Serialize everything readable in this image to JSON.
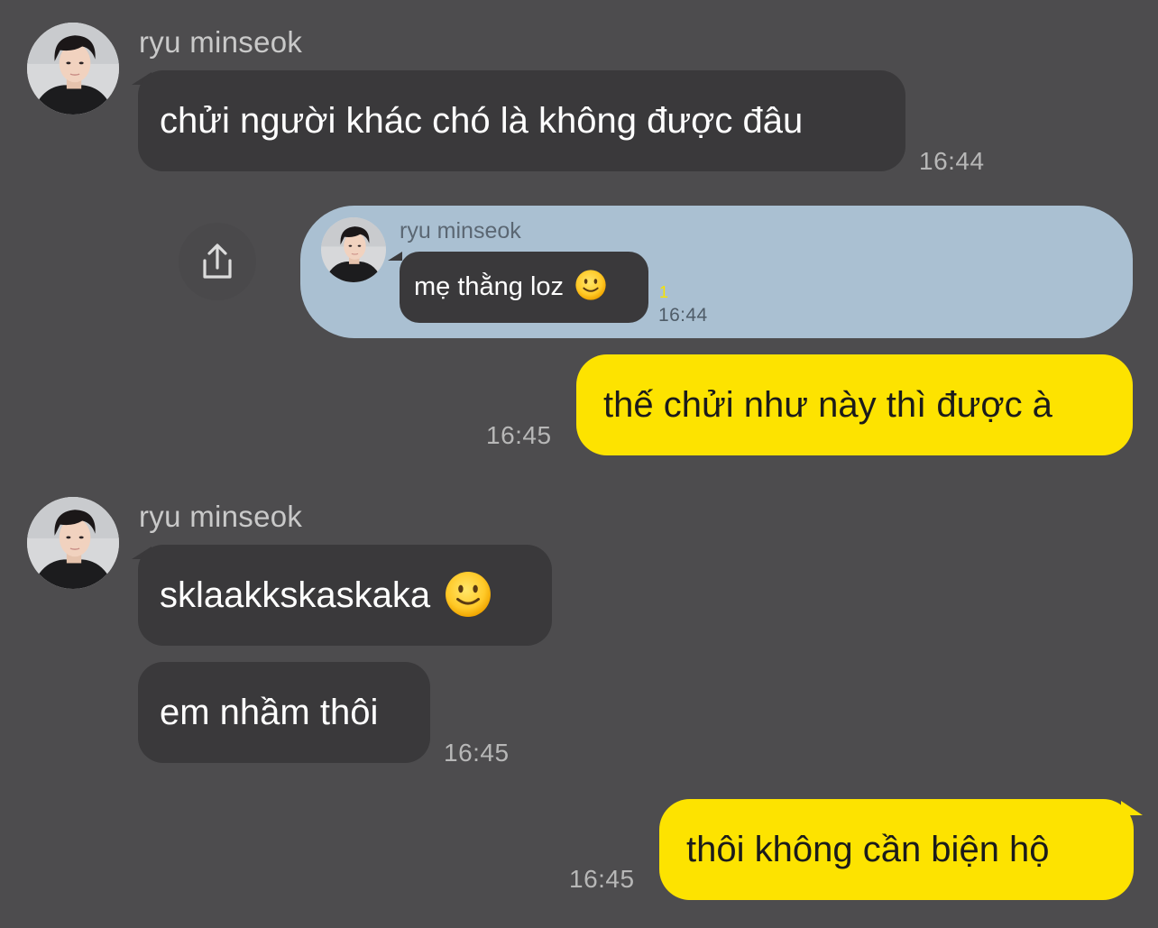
{
  "chat": {
    "groups": [
      {
        "sender": "ryu minseok",
        "messages": [
          {
            "text": "chửi người khác chó là không được đâu",
            "time": "16:44"
          }
        ]
      },
      {
        "sender": "ryu minseok",
        "messages": [
          {
            "text": "sklaakkskaskaka",
            "emoji": "slightly-smiling-face"
          },
          {
            "text": "em nhầm thôi",
            "time": "16:45"
          }
        ]
      }
    ],
    "forwarded": {
      "sender": "ryu minseok",
      "text": "mẹ thằng loz",
      "emoji": "slightly-smiling-face",
      "unread": "1",
      "time": "16:44",
      "share_icon": "share-icon"
    },
    "outgoing": [
      {
        "text": "thế chửi như này thì được à",
        "time": "16:45"
      },
      {
        "text": "thôi không cần biện hộ",
        "time": "16:45"
      }
    ]
  },
  "colors": {
    "background": "#4d4c4e",
    "incoming_bubble": "#3a393b",
    "outgoing_bubble": "#fde300",
    "forward_card": "#aac0d2"
  }
}
